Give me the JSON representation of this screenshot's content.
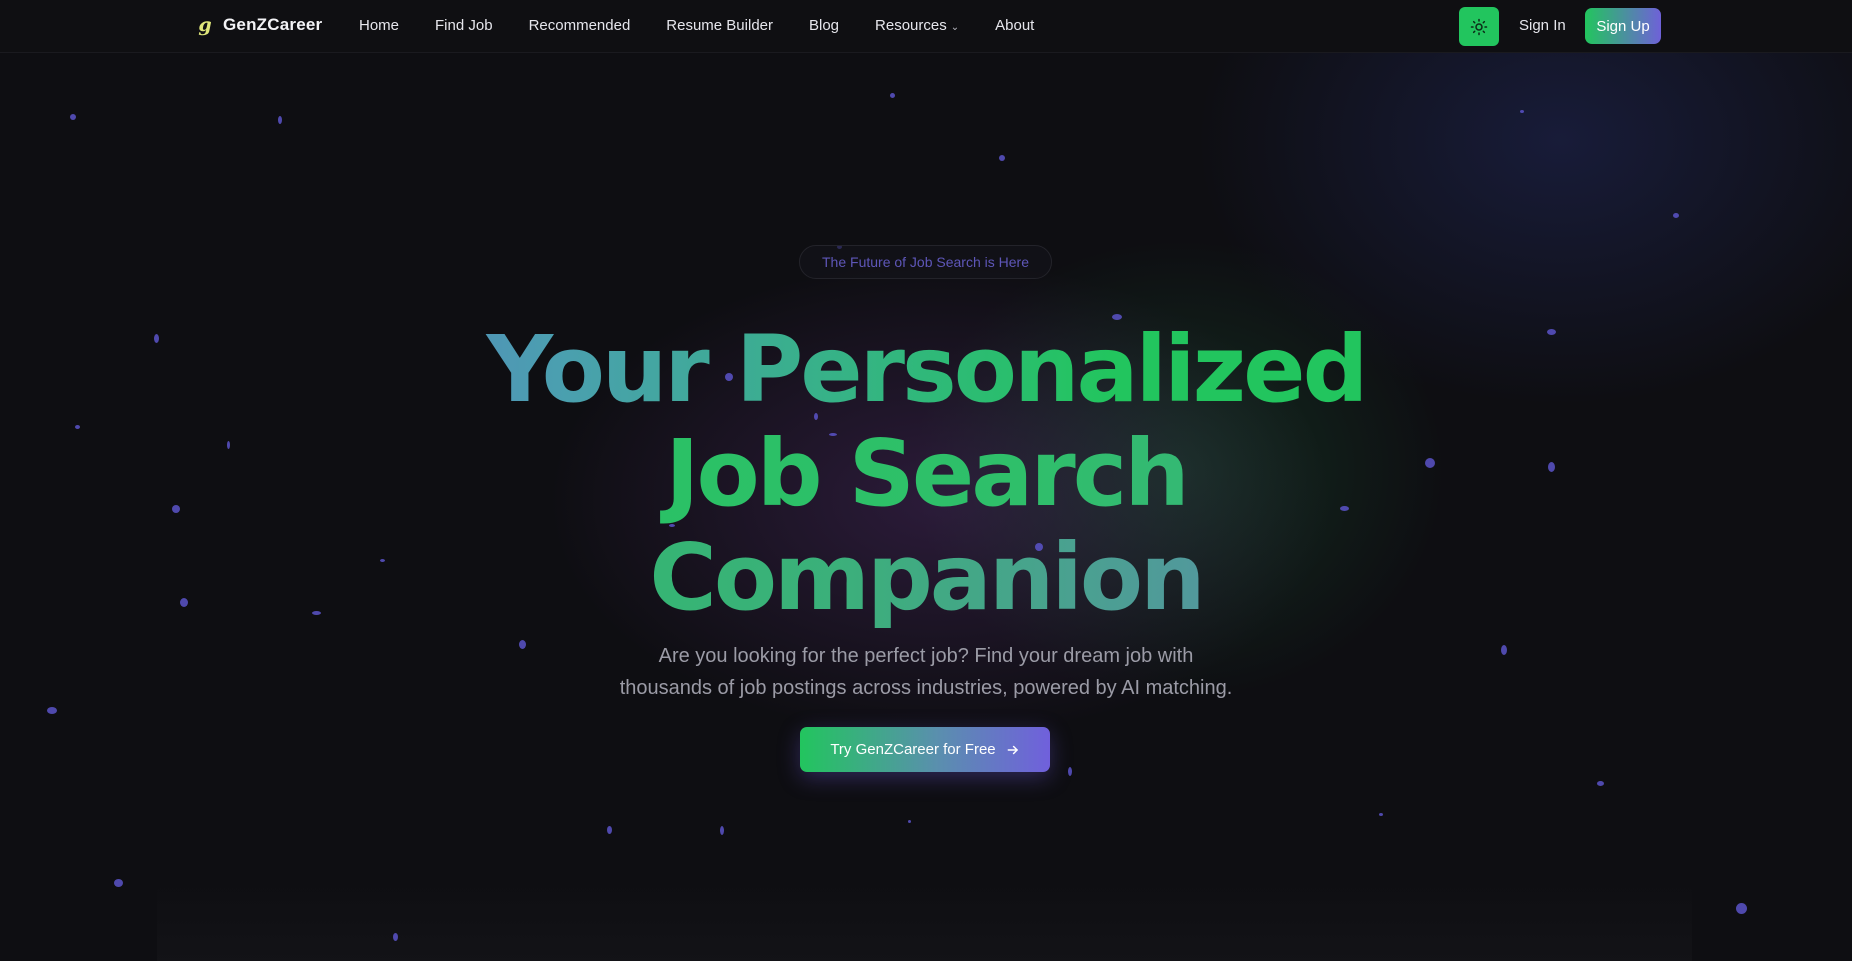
{
  "nav": {
    "logo_text": "GenZCareer",
    "links": [
      {
        "label": "Home"
      },
      {
        "label": "Find Job"
      },
      {
        "label": "Recommended"
      },
      {
        "label": "Resume Builder"
      },
      {
        "label": "Blog"
      },
      {
        "label": "Resources"
      },
      {
        "label": "About"
      }
    ],
    "theme_icon": "sun-icon",
    "signin_label": "Sign In",
    "signup_label": "Sign Up"
  },
  "hero": {
    "badge": "The Future of Job Search is Here",
    "headline": [
      "Your Personalized",
      "Job Search",
      "Companion"
    ],
    "subtext": [
      "Are you looking for the perfect job? Find your dream job with",
      "thousands of job postings across industries, powered by AI matching."
    ],
    "cta_label": "Try GenZCareer for Free",
    "cta_icon": "arrow-right-icon"
  },
  "colors": {
    "accent_green": "#22c55e",
    "accent_purple": "#6f61d8",
    "background": "#0e0e12"
  }
}
